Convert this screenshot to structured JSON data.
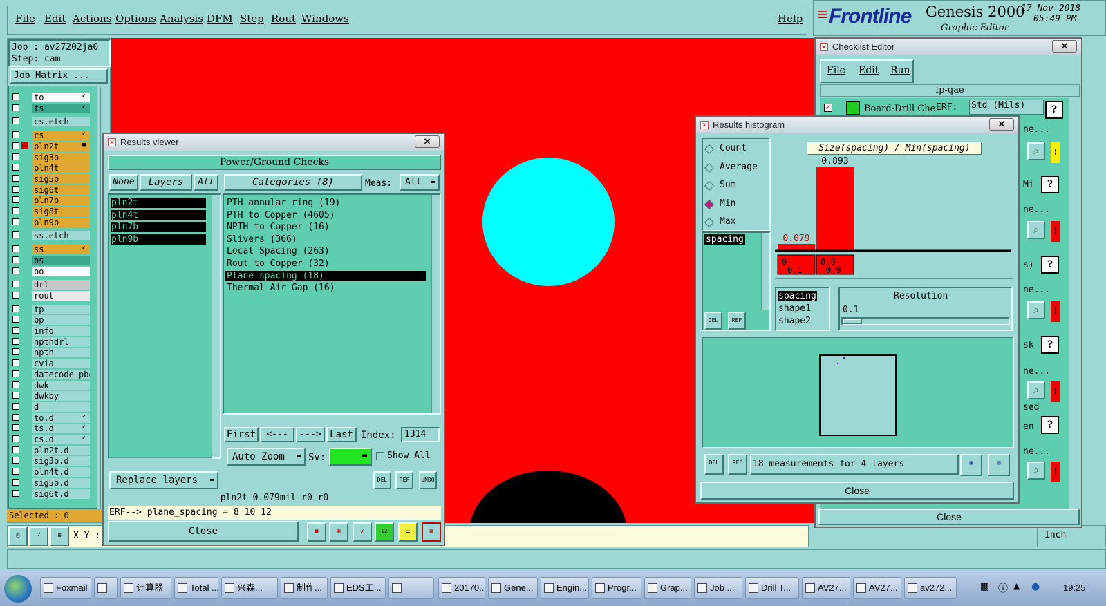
{
  "menu": {
    "items": [
      "File",
      "Edit",
      "Actions",
      "Options",
      "Analysis",
      "DFM",
      "Step",
      "Rout",
      "Windows"
    ],
    "help": "Help"
  },
  "brand": {
    "logo": "Frontline",
    "product": "Genesis 2000",
    "subtitle": "Graphic Editor",
    "date": "17 Nov 2018",
    "time": "05:49 PM"
  },
  "job": {
    "job_label": "Job : av27202ja0",
    "step_label": "Step: cam",
    "matrix_button": "Job Matrix ..."
  },
  "layers": [
    {
      "name": "to",
      "bg": "#ffffff",
      "arrow": "⬋"
    },
    {
      "name": "ts",
      "bg": "#3aa88c",
      "arrow": "⬋"
    },
    {
      "name": "cs.etch",
      "bg": "#9ed8d4",
      "arrow": ""
    },
    {
      "name": "cs",
      "bg": "#e0a830",
      "arrow": "⬋"
    },
    {
      "name": "pln2t",
      "bg": "#e0a830",
      "arrow": "■"
    },
    {
      "name": "sig3b",
      "bg": "#e0a830",
      "arrow": ""
    },
    {
      "name": "pln4t",
      "bg": "#e0a830",
      "arrow": ""
    },
    {
      "name": "sig5b",
      "bg": "#e0a830",
      "arrow": ""
    },
    {
      "name": "sig6t",
      "bg": "#e0a830",
      "arrow": ""
    },
    {
      "name": "pln7b",
      "bg": "#e0a830",
      "arrow": ""
    },
    {
      "name": "sig8t",
      "bg": "#e0a830",
      "arrow": ""
    },
    {
      "name": "pln9b",
      "bg": "#e0a830",
      "arrow": ""
    },
    {
      "name": "ss.etch",
      "bg": "#9ed8d4",
      "arrow": ""
    },
    {
      "name": "ss",
      "bg": "#e0a830",
      "arrow": "⬋"
    },
    {
      "name": "bs",
      "bg": "#3aa88c",
      "arrow": ""
    },
    {
      "name": "bo",
      "bg": "#ffffff",
      "arrow": ""
    },
    {
      "name": "drl",
      "bg": "#c8c8c8",
      "arrow": ""
    },
    {
      "name": "rout",
      "bg": "#e8e8e8",
      "arrow": ""
    },
    {
      "name": "tp",
      "bg": "#9ed8d4",
      "arrow": ""
    },
    {
      "name": "bp",
      "bg": "#9ed8d4",
      "arrow": ""
    },
    {
      "name": "info",
      "bg": "#9ed8d4",
      "arrow": ""
    },
    {
      "name": "npthdrl",
      "bg": "#9ed8d4",
      "arrow": ""
    },
    {
      "name": "npth",
      "bg": "#9ed8d4",
      "arrow": ""
    },
    {
      "name": "cvia",
      "bg": "#9ed8d4",
      "arrow": ""
    },
    {
      "name": "datecode-pbo",
      "bg": "#9ed8d4",
      "arrow": ""
    },
    {
      "name": "dwk",
      "bg": "#9ed8d4",
      "arrow": ""
    },
    {
      "name": "dwkby",
      "bg": "#9ed8d4",
      "arrow": ""
    },
    {
      "name": "d",
      "bg": "#9ed8d4",
      "arrow": ""
    },
    {
      "name": "to.d",
      "bg": "#9ed8d4",
      "arrow": "⬋"
    },
    {
      "name": "ts.d",
      "bg": "#9ed8d4",
      "arrow": "⬋"
    },
    {
      "name": "cs.d",
      "bg": "#9ed8d4",
      "arrow": "⬋"
    },
    {
      "name": "pln2t.d",
      "bg": "#9ed8d4",
      "arrow": ""
    },
    {
      "name": "sig3b.d",
      "bg": "#9ed8d4",
      "arrow": ""
    },
    {
      "name": "pln4t.d",
      "bg": "#9ed8d4",
      "arrow": ""
    },
    {
      "name": "sig5b.d",
      "bg": "#9ed8d4",
      "arrow": ""
    },
    {
      "name": "sig6t.d",
      "bg": "#9ed8d4",
      "arrow": ""
    }
  ],
  "selected_label": "Selected : 0",
  "xy_label": "X Y :",
  "units": "Inch",
  "results_viewer": {
    "title": "Results viewer",
    "header": "Power/Ground Checks",
    "btn_none": "None",
    "btn_layers": "Layers",
    "btn_all": "All",
    "categories_label": "Categories (8)",
    "meas_label": "Meas:",
    "meas_value": "All",
    "layers": [
      "pln2t",
      "pln4t",
      "pln7b",
      "pln9b"
    ],
    "categories": [
      "PTH annular ring (19)",
      "PTH to Copper (4605)",
      "NPTH to Copper (16)",
      "Slivers (366)",
      "Local Spacing (263)",
      "Rout to Copper (32)",
      "Plane spacing (18)",
      "Thermal Air Gap (16)"
    ],
    "selected_category_index": 6,
    "nav": {
      "first": "First",
      "prev": "<---",
      "next": "--->",
      "last": "Last",
      "index_label": "Index:",
      "index_value": "1314"
    },
    "zoom": "Auto Zoom",
    "sv_label": "Sv:",
    "show_all": "Show All",
    "replace": "Replace layers",
    "icons": {
      "del": "DEL",
      "ref": "REF",
      "undo": "UNDO"
    },
    "status": "pln2t 0.079mil  r0  r0",
    "erf": "ERF--> plane_spacing = 8 10 12",
    "close": "Close"
  },
  "histogram": {
    "title": "Results histogram",
    "modes": [
      "Count",
      "Average",
      "Sum",
      "Min",
      "Max"
    ],
    "selected_mode": "Min",
    "attr_selected": "spacing",
    "chart_title": "Size(spacing) / Min(spacing)",
    "bars": [
      {
        "range": "0- 0.1",
        "value": 0.079,
        "label": "0.079",
        "label_color": "#c00000"
      },
      {
        "range": "0.8- 0.9",
        "value": 0.893,
        "label": "0.893",
        "label_color": "#000000"
      }
    ],
    "attrs": [
      "spacing",
      "shape1",
      "shape2"
    ],
    "resolution_label": "Resolution",
    "resolution_value": "0.1",
    "measurements": "18 measurements for 4 layers",
    "icons": {
      "del": "DEL",
      "ref": "REF"
    },
    "close": "Close"
  },
  "checklist": {
    "title": "Checklist Editor",
    "menu": [
      "File",
      "Edit",
      "Run"
    ],
    "name": "fp-qae",
    "first_row": "Board-Drill Che",
    "erf": "ERF:",
    "std": "Std (Mils)",
    "partials": [
      "ne...",
      "Mi",
      "ne...",
      "s)",
      "ne...",
      "sk",
      "ne...",
      "sed",
      "en",
      "ne..."
    ],
    "close": "Close"
  },
  "taskbar": {
    "items": [
      "Foxmail",
      "",
      "计算器",
      "Total ...",
      "兴森...",
      "制作...",
      "EDS工...",
      "",
      "20170...",
      "Gene...",
      "Engin...",
      "Progr...",
      "Grap...",
      "Job ...",
      "Drill T...",
      "AV27...",
      "AV27...",
      "av272..."
    ],
    "clock": "19:25"
  }
}
